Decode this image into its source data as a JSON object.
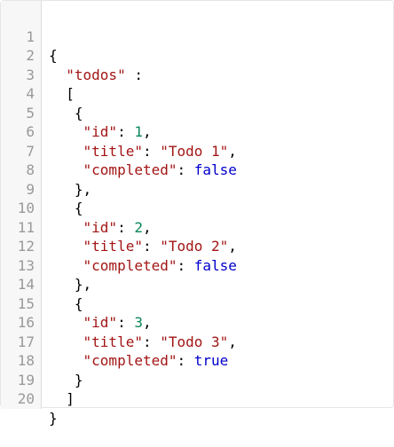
{
  "editor": {
    "line_numbers": [
      "1",
      "2",
      "3",
      "4",
      "5",
      "6",
      "7",
      "8",
      "9",
      "10",
      "11",
      "12",
      "13",
      "14",
      "15",
      "16",
      "17",
      "18",
      "19",
      "20"
    ],
    "tokens": {
      "open_brace": "{",
      "close_brace": "}",
      "open_bracket": "[",
      "close_bracket": "]",
      "close_brace_comma": "},",
      "colon": ":",
      "colon_space": ": ",
      "space_colon": " :",
      "comma": ",",
      "key_todos": "\"todos\"",
      "key_id": "\"id\"",
      "key_title": "\"title\"",
      "key_completed": "\"completed\""
    },
    "todos": [
      {
        "id": "1",
        "title": "\"Todo 1\"",
        "completed": "false"
      },
      {
        "id": "2",
        "title": "\"Todo 2\"",
        "completed": "false"
      },
      {
        "id": "3",
        "title": "\"Todo 3\"",
        "completed": "true"
      }
    ]
  },
  "colors": {
    "key_string": "#a31515",
    "number": "#098658",
    "boolean": "#0000cc",
    "gutter_text": "#999999"
  }
}
